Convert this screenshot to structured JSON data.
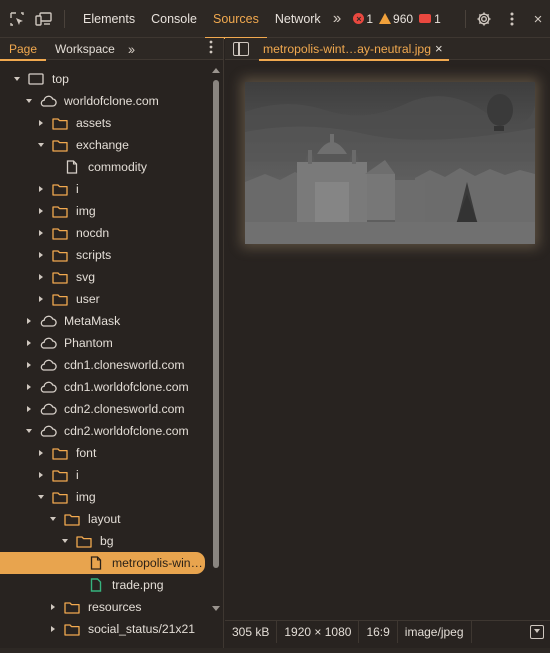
{
  "toolbar": {
    "tabs": [
      {
        "label": "Elements",
        "active": false
      },
      {
        "label": "Console",
        "active": false
      },
      {
        "label": "Sources",
        "active": true
      },
      {
        "label": "Network",
        "active": false
      }
    ],
    "more_tabs_icon": "double-chevron-right-icon",
    "errors_count": "1",
    "warnings_count": "960",
    "issues_count": "1",
    "colors": {
      "accent": "#f1a94f",
      "error": "#e9483f",
      "warning": "#f1a13b"
    }
  },
  "navigator": {
    "tabs": [
      {
        "label": "Page",
        "active": true
      },
      {
        "label": "Workspace",
        "active": false
      }
    ],
    "tree": [
      {
        "label": "top",
        "depth": 0,
        "type": "frame",
        "expanded": true
      },
      {
        "label": "worldofclone.com",
        "depth": 1,
        "type": "cloud",
        "expanded": true
      },
      {
        "label": "assets",
        "depth": 2,
        "type": "folder",
        "expanded": false
      },
      {
        "label": "exchange",
        "depth": 2,
        "type": "folder",
        "expanded": true
      },
      {
        "label": "commodity",
        "depth": 3,
        "type": "file",
        "expanded": null
      },
      {
        "label": "i",
        "depth": 2,
        "type": "folder",
        "expanded": false
      },
      {
        "label": "img",
        "depth": 2,
        "type": "folder",
        "expanded": false
      },
      {
        "label": "nocdn",
        "depth": 2,
        "type": "folder",
        "expanded": false
      },
      {
        "label": "scripts",
        "depth": 2,
        "type": "folder",
        "expanded": false
      },
      {
        "label": "svg",
        "depth": 2,
        "type": "folder",
        "expanded": false
      },
      {
        "label": "user",
        "depth": 2,
        "type": "folder",
        "expanded": false
      },
      {
        "label": "MetaMask",
        "depth": 1,
        "type": "cloud",
        "expanded": false
      },
      {
        "label": "Phantom",
        "depth": 1,
        "type": "cloud",
        "expanded": false
      },
      {
        "label": "cdn1.clonesworld.com",
        "depth": 1,
        "type": "cloud",
        "expanded": false
      },
      {
        "label": "cdn1.worldofclone.com",
        "depth": 1,
        "type": "cloud",
        "expanded": false
      },
      {
        "label": "cdn2.clonesworld.com",
        "depth": 1,
        "type": "cloud",
        "expanded": false
      },
      {
        "label": "cdn2.worldofclone.com",
        "depth": 1,
        "type": "cloud",
        "expanded": true
      },
      {
        "label": "font",
        "depth": 2,
        "type": "folder",
        "expanded": false
      },
      {
        "label": "i",
        "depth": 2,
        "type": "folder",
        "expanded": false
      },
      {
        "label": "img",
        "depth": 2,
        "type": "folder",
        "expanded": true
      },
      {
        "label": "layout",
        "depth": 3,
        "type": "folder",
        "expanded": true
      },
      {
        "label": "bg",
        "depth": 4,
        "type": "folder",
        "expanded": true
      },
      {
        "label": "metropolis-win…",
        "depth": 5,
        "type": "file",
        "expanded": null,
        "selected": true
      },
      {
        "label": "trade.png",
        "depth": 5,
        "type": "image-file",
        "expanded": null
      },
      {
        "label": "resources",
        "depth": 3,
        "type": "folder",
        "expanded": false
      },
      {
        "label": "social_status/21x21",
        "depth": 3,
        "type": "folder",
        "expanded": false
      }
    ]
  },
  "editor": {
    "open_file": "metropolis-wint…ay-neutral.jpg",
    "status": {
      "size": "305 kB",
      "dimensions": "1920 × 1080",
      "ratio": "16:9",
      "mime": "image/jpeg"
    }
  }
}
